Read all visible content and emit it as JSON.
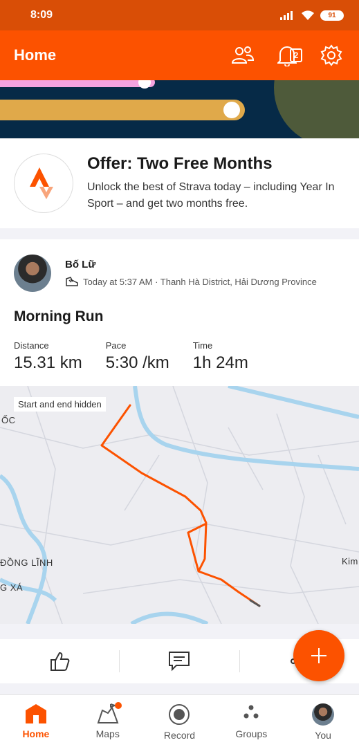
{
  "status_bar": {
    "time": "8:09",
    "battery": "91"
  },
  "header": {
    "title": "Home",
    "notification_count": "2"
  },
  "offer": {
    "title": "Offer: Two Free Months",
    "body": "Unlock the best of Strava today – including Year In Sport – and get two months free."
  },
  "activity": {
    "athlete_name": "Bố Lữ",
    "meta": "Today at 5:37 AM · Thanh Hà District, Hải Dương Province",
    "title": "Morning Run",
    "stats": [
      {
        "label": "Distance",
        "value": "15.31 km"
      },
      {
        "label": "Pace",
        "value": "5:30 /km"
      },
      {
        "label": "Time",
        "value": "1h 24m"
      }
    ],
    "map_note": "Start and end hidden",
    "map_labels": [
      "ỐC",
      "ĐỒNG LĨNH",
      "G XÁ",
      "Kim"
    ]
  },
  "nav": {
    "items": [
      {
        "label": "Home"
      },
      {
        "label": "Maps"
      },
      {
        "label": "Record"
      },
      {
        "label": "Groups"
      },
      {
        "label": "You"
      }
    ]
  },
  "colors": {
    "brand": "#fc5200",
    "status_bar": "#d94e06",
    "banner": "#062a47"
  },
  "icons": [
    "signal-icon",
    "wifi-icon",
    "battery-icon",
    "friends-icon",
    "bell-icon",
    "settings-gear-icon",
    "strava-logo-icon",
    "shoe-icon",
    "thumbs-up-icon",
    "comment-icon",
    "share-icon",
    "plus-icon",
    "home-icon",
    "maps-icon",
    "record-icon",
    "groups-icon"
  ]
}
